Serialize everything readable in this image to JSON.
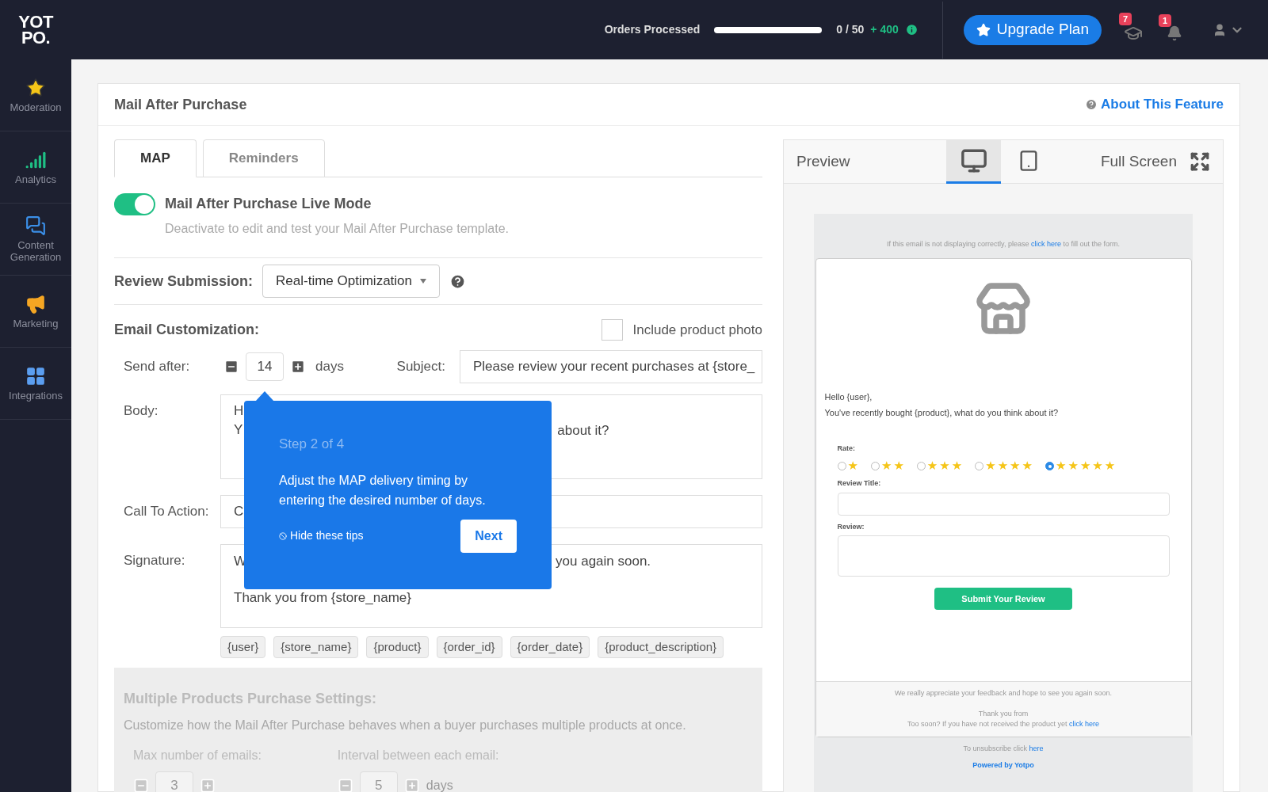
{
  "logo": {
    "lines": [
      "YOT",
      "PO."
    ]
  },
  "topbar": {
    "orders_label": "Orders Processed",
    "orders_progress": {
      "level": 0
    },
    "orders_count": "0 / 50",
    "orders_bonus": "+ 400",
    "upgrade": "Upgrade Plan",
    "academy_badge": "7",
    "notifications_badge": "1"
  },
  "sidebar": {
    "items": [
      {
        "label": "Moderation",
        "kind": "star",
        "color": "#f5c518"
      },
      {
        "label": "Analytics",
        "kind": "bars",
        "color": "#1fbf84"
      },
      {
        "label": "Content Generation",
        "kind": "chat",
        "color": "#3b8fe8"
      },
      {
        "label": "Marketing",
        "kind": "megaphone",
        "color": "#f5a623"
      },
      {
        "label": "Integrations",
        "kind": "grid",
        "color": "#5b9ef0"
      }
    ]
  },
  "page": {
    "title": "Mail After Purchase",
    "about": "About This Feature"
  },
  "tabs": [
    {
      "label": "MAP",
      "selected": true
    },
    {
      "label": "Reminders",
      "selected": false
    }
  ],
  "live_mode": {
    "title": "Mail After Purchase Live Mode",
    "hint": "Deactivate to edit and test your Mail After Purchase template.",
    "on": true
  },
  "review_submission": {
    "label": "Review Submission:",
    "value": "Real-time Optimization"
  },
  "email": {
    "label": "Email Customization:",
    "include_photo": {
      "label": "Include product photo",
      "checked": false
    },
    "send_after_label": "Send after:",
    "send_after_value": "14",
    "send_after_unit": "days",
    "subject_label": "Subject:",
    "subject_value": "Please review your recent purchases at {store_",
    "body_label": "Body:",
    "body_left": [
      "H",
      "Y"
    ],
    "body_right": "about it?",
    "cta_label": "Call To Action:",
    "cta_left": "C",
    "signature_label": "Signature:",
    "signature_left": "W",
    "signature_right": "you again soon.",
    "signature_line2": "Thank you from {store_name}",
    "tags": [
      "{user}",
      "{store_name}",
      "{product}",
      "{order_id}",
      "{order_date}",
      "{product_description}"
    ]
  },
  "multiple": {
    "disabled": true,
    "title": "Multiple Products Purchase Settings:",
    "description": "Customize how the Mail After Purchase behaves when a buyer purchases multiple products at once.",
    "max_label": "Max number of emails:",
    "max_value": "3",
    "interval_label": "Interval between each email:",
    "interval_value": "5",
    "interval_unit": "days"
  },
  "tip": {
    "step": "Step 2 of 4",
    "text": "Adjust the MAP delivery timing by entering the desired number of days.",
    "hide": "Hide these tips",
    "next": "Next"
  },
  "preview": {
    "title": "Preview",
    "devices": [
      {
        "kind": "desktop",
        "selected": true
      },
      {
        "kind": "tablet",
        "selected": false
      }
    ],
    "full_screen": "Full Screen",
    "notice_before": "If this email is not displaying correctly, please",
    "notice_link": "click here",
    "notice_after": "to fill out the form.",
    "greeting": "Hello {user},",
    "message": "You've recently bought {product}, what do you think about it?",
    "rate_label": "Rate:",
    "rate_options": [
      {
        "label": "★",
        "selected": false
      },
      {
        "label": "★★",
        "selected": false
      },
      {
        "label": "★★★",
        "selected": false
      },
      {
        "label": "★★★★",
        "selected": false
      },
      {
        "label": "★★★★★",
        "selected": true
      }
    ],
    "title_label": "Review Title:",
    "review_label": "Review:",
    "submit": "Submit Your Review",
    "footer_text": "We really appreciate your feedback and hope to see you again soon.",
    "thanks": "Thank you from",
    "too_soon": "Too soon? If you have not received the product yet",
    "too_soon_link": "click here",
    "unsubscribe": "To unsubscribe click",
    "unsubscribe_link": "here",
    "powered": "Powered by Yotpo"
  }
}
